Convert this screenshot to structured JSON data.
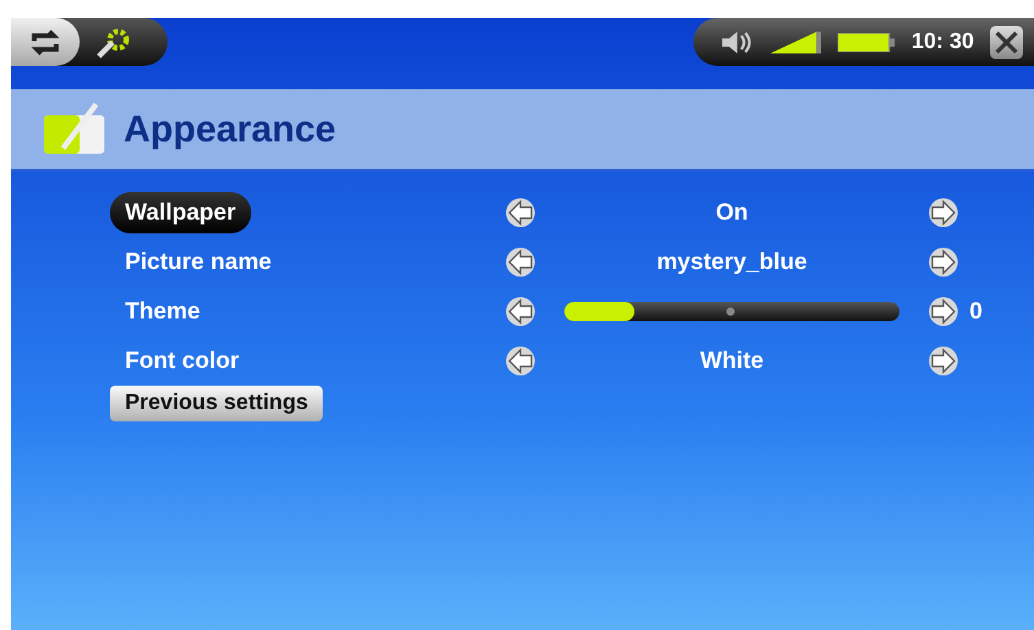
{
  "status_bar": {
    "time": "10: 30"
  },
  "header": {
    "title": "Appearance"
  },
  "settings": [
    {
      "kind": "value",
      "label": "Wallpaper",
      "selected": true,
      "value": "On"
    },
    {
      "kind": "value",
      "label": "Picture name",
      "selected": false,
      "value": "mystery_blue"
    },
    {
      "kind": "slider",
      "label": "Theme",
      "selected": false,
      "level": 0.21,
      "reading": "0"
    },
    {
      "kind": "value",
      "label": "Font color",
      "selected": false,
      "value": "White"
    }
  ],
  "buttons": [
    {
      "label": "Previous settings"
    }
  ]
}
